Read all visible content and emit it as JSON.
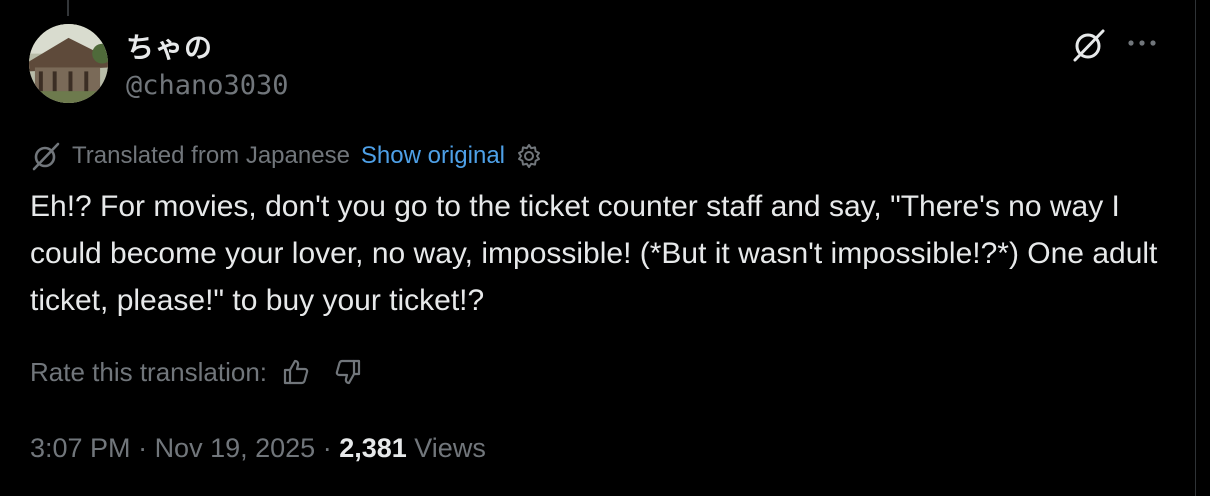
{
  "author": {
    "display_name": "ちゃの",
    "handle": "@chano3030"
  },
  "header_actions": {
    "grok_icon": "grok-slash-icon",
    "more_icon": "more-dots-icon"
  },
  "translation": {
    "label": "Translated from Japanese",
    "show_original": "Show original",
    "settings_icon": "gear-icon"
  },
  "tweet": {
    "text": "Eh!? For movies, don't you go to the ticket counter staff and say, \"There's no way I could become your lover, no way, impossible! (*But it wasn't impossible!?*) One adult ticket, please!\" to buy your ticket!?"
  },
  "rating": {
    "label": "Rate this translation:",
    "up_icon": "thumbs-up-icon",
    "down_icon": "thumbs-down-icon"
  },
  "meta": {
    "time": "3:07 PM",
    "separator": " · ",
    "date": "Nov 19, 2025",
    "views_count": "2,381",
    "views_label": "Views"
  },
  "colors": {
    "background": "#000000",
    "text_primary": "#e7e9ea",
    "text_secondary": "#71767b",
    "link": "#4ea0e7"
  }
}
